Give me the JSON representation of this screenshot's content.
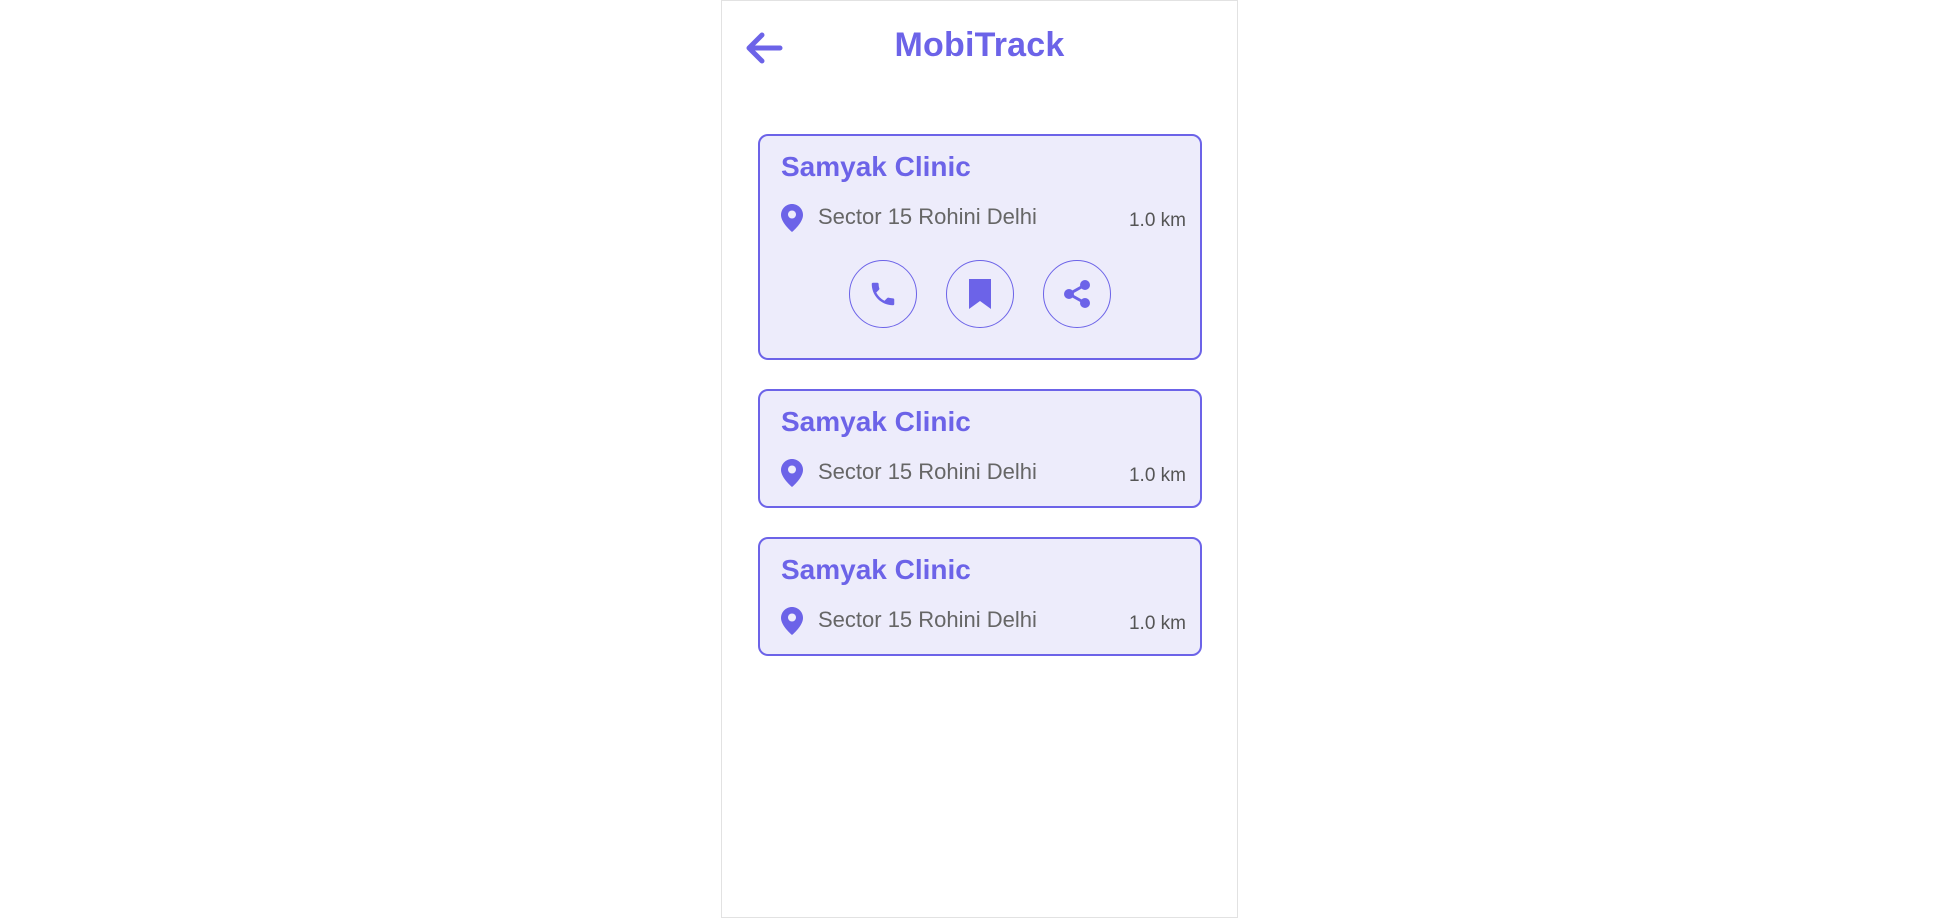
{
  "header": {
    "title": "MobiTrack",
    "back_icon": "arrow-left-icon"
  },
  "colors": {
    "accent": "#6c63e8",
    "card_background": "#edecfb",
    "text_muted": "#666666"
  },
  "clinics": [
    {
      "name": "Samyak Clinic",
      "address": "Sector 15 Rohini Delhi",
      "distance": "1.0 km",
      "expanded": true,
      "actions": [
        "phone-icon",
        "bookmark-icon",
        "share-icon"
      ]
    },
    {
      "name": "Samyak Clinic",
      "address": "Sector 15 Rohini Delhi",
      "distance": "1.0 km",
      "expanded": false
    },
    {
      "name": "Samyak Clinic",
      "address": "Sector 15 Rohini Delhi",
      "distance": "1.0 km",
      "expanded": false
    }
  ]
}
